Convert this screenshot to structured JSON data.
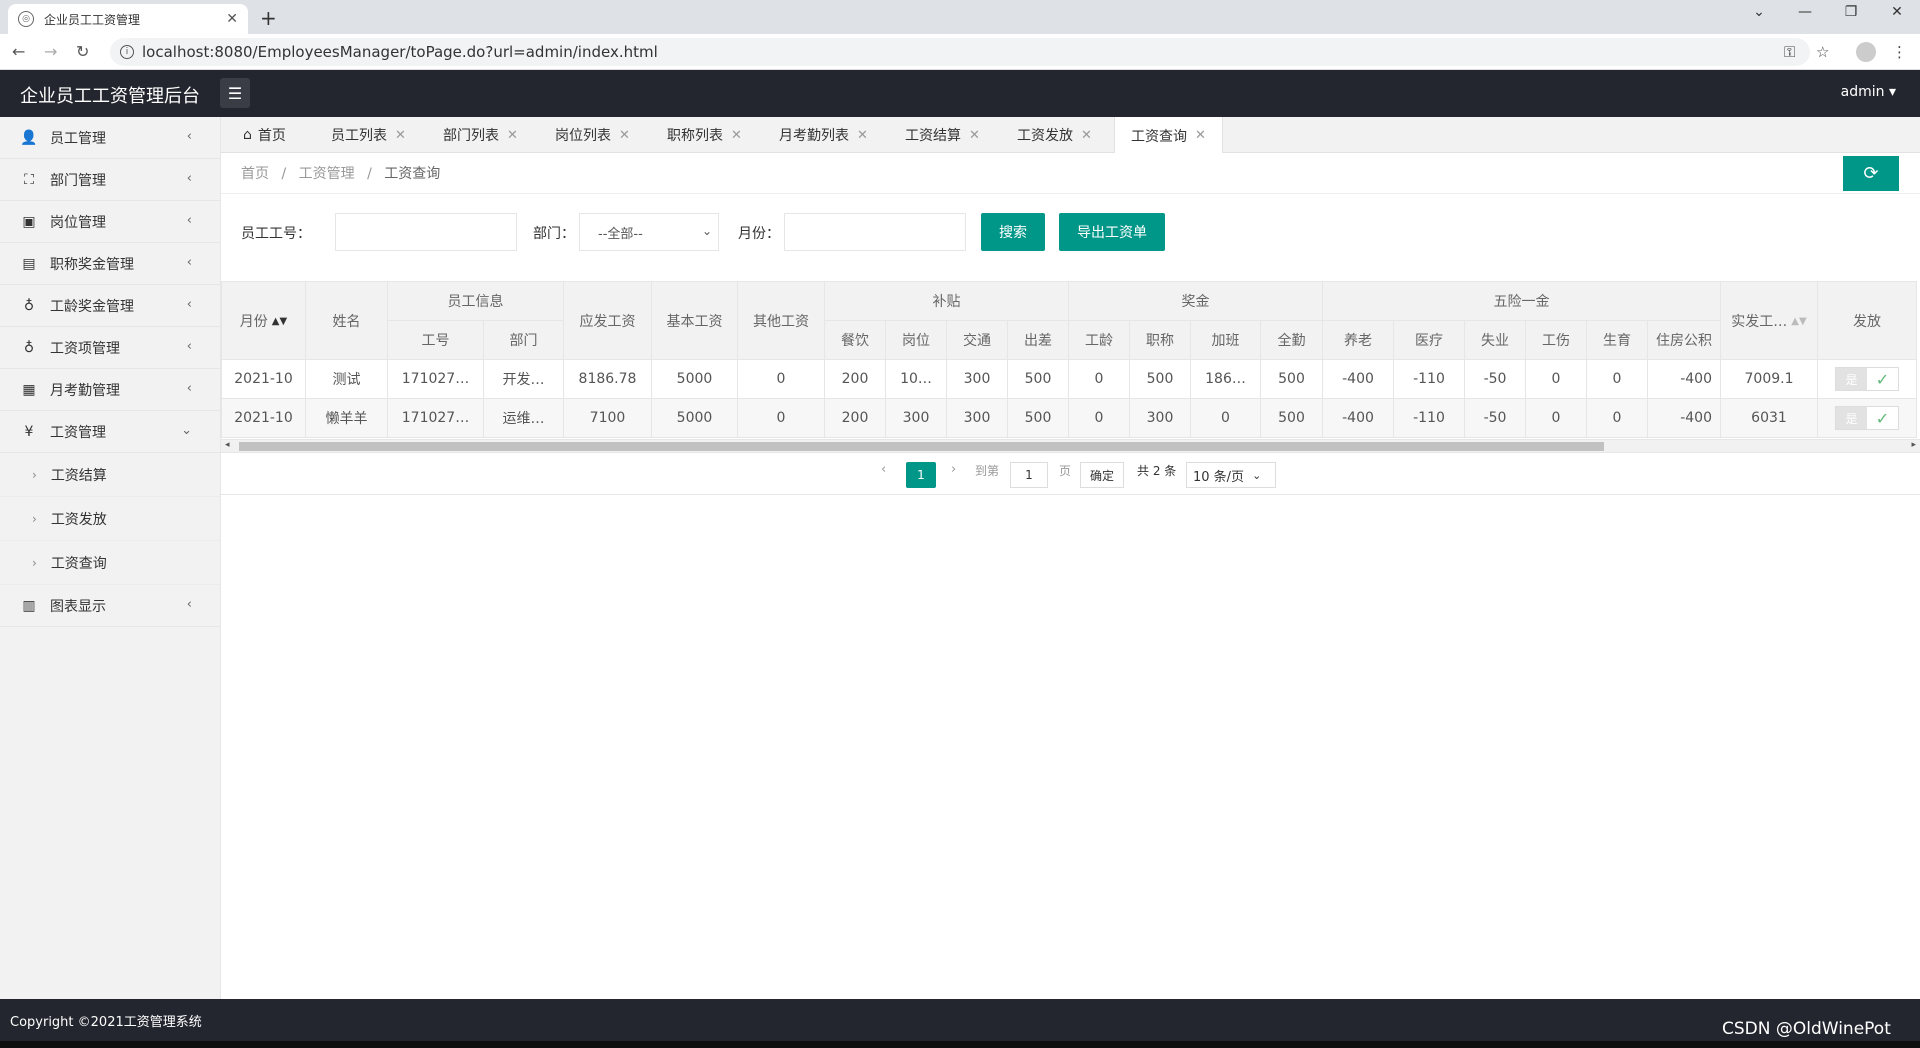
{
  "browser": {
    "tab_title": "企业员工工资管理",
    "url": "localhost:8080/EmployeesManager/toPage.do?url=admin/index.html"
  },
  "header": {
    "logo": "企业员工工资管理后台",
    "user": "admin"
  },
  "sidebar": {
    "items": [
      {
        "label": "员工管理",
        "icon": "user-icon"
      },
      {
        "label": "部门管理",
        "icon": "sitemap-icon"
      },
      {
        "label": "岗位管理",
        "icon": "badge-icon"
      },
      {
        "label": "职称奖金管理",
        "icon": "archive-icon"
      },
      {
        "label": "工龄奖金管理",
        "icon": "money-bag-icon"
      },
      {
        "label": "工资项管理",
        "icon": "money-bag-icon"
      },
      {
        "label": "月考勤管理",
        "icon": "calendar-icon"
      },
      {
        "label": "工资管理",
        "icon": "yen-icon"
      }
    ],
    "sub_items": [
      "工资结算",
      "工资发放",
      "工资查询"
    ],
    "chart_item": {
      "label": "图表显示",
      "icon": "bar-chart-icon"
    }
  },
  "tabs": [
    {
      "label": "首页"
    },
    {
      "label": "员工列表"
    },
    {
      "label": "部门列表"
    },
    {
      "label": "岗位列表"
    },
    {
      "label": "职称列表"
    },
    {
      "label": "月考勤列表"
    },
    {
      "label": "工资结算"
    },
    {
      "label": "工资发放"
    },
    {
      "label": "工资查询"
    }
  ],
  "breadcrumb": {
    "home": "首页",
    "sep": "/",
    "parent": "工资管理",
    "current": "工资查询"
  },
  "search": {
    "emp_no_label": "员工工号：",
    "dept_label": "部门：",
    "dept_value": "--全部--",
    "month_label": "月份：",
    "search_btn": "搜索",
    "export_btn": "导出工资单"
  },
  "table": {
    "h": {
      "month": "月份",
      "name": "姓名",
      "emp_info": "员工信息",
      "emp_no": "工号",
      "dept": "部门",
      "gross": "应发工资",
      "base": "基本工资",
      "other": "其他工资",
      "allowance": "补贴",
      "meal": "餐饮",
      "post": "岗位",
      "traffic": "交通",
      "trip": "出差",
      "bonus": "奖金",
      "seniority": "工龄",
      "title": "职称",
      "overtime": "加班",
      "attendance": "全勤",
      "insurance": "五险一金",
      "pension": "养老",
      "medical": "医疗",
      "unemployment": "失业",
      "injury": "工伤",
      "maternity": "生育",
      "housing": "住房公积",
      "net": "实发工…",
      "issue": "发放"
    },
    "rows": [
      {
        "month": "2021-10",
        "name": "测试",
        "emp_no": "171027…",
        "dept": "开发…",
        "gross": "8186.78",
        "base": "5000",
        "other": "0",
        "meal": "200",
        "post": "10…",
        "traffic": "300",
        "trip": "500",
        "seniority": "0",
        "title": "500",
        "overtime": "186…",
        "attendance": "500",
        "pension": "-400",
        "medical": "-110",
        "unemployment": "-50",
        "injury": "0",
        "maternity": "0",
        "housing": "-400",
        "net": "7009.1",
        "issue_label": "是"
      },
      {
        "month": "2021-10",
        "name": "懒羊羊",
        "emp_no": "171027…",
        "dept": "运维…",
        "gross": "7100",
        "base": "5000",
        "other": "0",
        "meal": "200",
        "post": "300",
        "traffic": "300",
        "trip": "500",
        "seniority": "0",
        "title": "300",
        "overtime": "0",
        "attendance": "500",
        "pension": "-400",
        "medical": "-110",
        "unemployment": "-50",
        "injury": "0",
        "maternity": "0",
        "housing": "-400",
        "net": "6031",
        "issue_label": "是"
      }
    ]
  },
  "pager": {
    "current": "1",
    "goto_label": "到第",
    "goto_value": "1",
    "page_unit": "页",
    "confirm": "确定",
    "total": "共 2 条",
    "page_size": "10 条/页"
  },
  "footer": {
    "copyright": "Copyright ©2021工资管理系统"
  },
  "watermark": "CSDN @OldWinePot",
  "colors": {
    "accent": "#009688",
    "header": "#23262e"
  }
}
